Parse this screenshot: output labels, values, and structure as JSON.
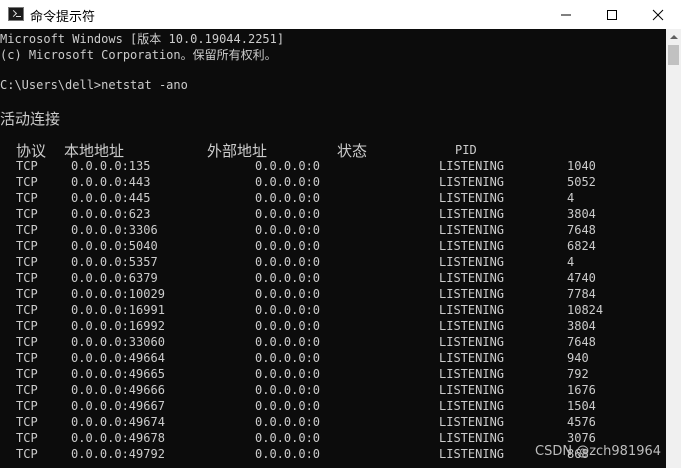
{
  "window": {
    "title": "命令提示符",
    "icon": "cmd-icon"
  },
  "console": {
    "lines": [
      "Microsoft Windows [版本 10.0.19044.2251]",
      "(c) Microsoft Corporation。保留所有权利。",
      "",
      "C:\\Users\\dell>netstat -ano",
      "",
      "活动连接"
    ],
    "headers": [
      "协议",
      "本地地址",
      "外部地址",
      "状态",
      "PID"
    ],
    "rows": [
      [
        "TCP",
        "0.0.0.0:135",
        "0.0.0.0:0",
        "LISTENING",
        "1040"
      ],
      [
        "TCP",
        "0.0.0.0:443",
        "0.0.0.0:0",
        "LISTENING",
        "5052"
      ],
      [
        "TCP",
        "0.0.0.0:445",
        "0.0.0.0:0",
        "LISTENING",
        "4"
      ],
      [
        "TCP",
        "0.0.0.0:623",
        "0.0.0.0:0",
        "LISTENING",
        "3804"
      ],
      [
        "TCP",
        "0.0.0.0:3306",
        "0.0.0.0:0",
        "LISTENING",
        "7648"
      ],
      [
        "TCP",
        "0.0.0.0:5040",
        "0.0.0.0:0",
        "LISTENING",
        "6824"
      ],
      [
        "TCP",
        "0.0.0.0:5357",
        "0.0.0.0:0",
        "LISTENING",
        "4"
      ],
      [
        "TCP",
        "0.0.0.0:6379",
        "0.0.0.0:0",
        "LISTENING",
        "4740"
      ],
      [
        "TCP",
        "0.0.0.0:10029",
        "0.0.0.0:0",
        "LISTENING",
        "7784"
      ],
      [
        "TCP",
        "0.0.0.0:16991",
        "0.0.0.0:0",
        "LISTENING",
        "10824"
      ],
      [
        "TCP",
        "0.0.0.0:16992",
        "0.0.0.0:0",
        "LISTENING",
        "3804"
      ],
      [
        "TCP",
        "0.0.0.0:33060",
        "0.0.0.0:0",
        "LISTENING",
        "7648"
      ],
      [
        "TCP",
        "0.0.0.0:49664",
        "0.0.0.0:0",
        "LISTENING",
        "940"
      ],
      [
        "TCP",
        "0.0.0.0:49665",
        "0.0.0.0:0",
        "LISTENING",
        "792"
      ],
      [
        "TCP",
        "0.0.0.0:49666",
        "0.0.0.0:0",
        "LISTENING",
        "1676"
      ],
      [
        "TCP",
        "0.0.0.0:49667",
        "0.0.0.0:0",
        "LISTENING",
        "1504"
      ],
      [
        "TCP",
        "0.0.0.0:49674",
        "0.0.0.0:0",
        "LISTENING",
        "4576"
      ],
      [
        "TCP",
        "0.0.0.0:49678",
        "0.0.0.0:0",
        "LISTENING",
        "3076"
      ],
      [
        "TCP",
        "0.0.0.0:49792",
        "0.0.0.0:0",
        "LISTENING",
        "868"
      ]
    ]
  },
  "watermark": "CSDN @zch981964",
  "colors": {
    "console_bg": "#0c0c0c",
    "console_fg": "#cccccc",
    "titlebar_bg": "#ffffff"
  }
}
